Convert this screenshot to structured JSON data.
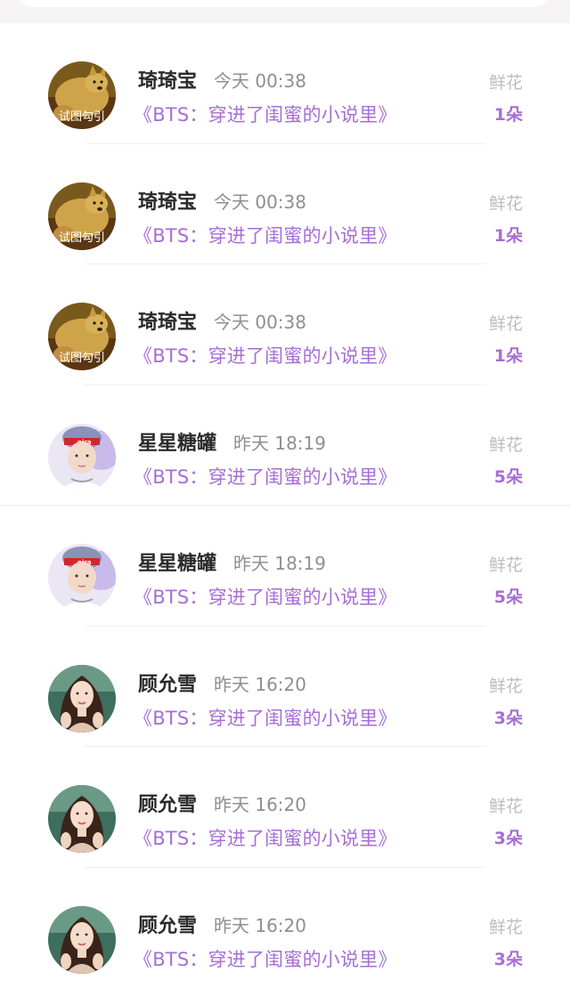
{
  "records": [
    {
      "name": "琦琦宝",
      "time": "今天 00:38",
      "book": "《BTS：穿进了闺蜜的小说里》",
      "gift_label": "鲜花",
      "gift_count": "1朵",
      "avatar": "dog-avatar",
      "avatar_caption": "试图勾引"
    },
    {
      "name": "琦琦宝",
      "time": "今天 00:38",
      "book": "《BTS：穿进了闺蜜的小说里》",
      "gift_label": "鲜花",
      "gift_count": "1朵",
      "avatar": "dog-avatar",
      "avatar_caption": "试图勾引"
    },
    {
      "name": "琦琦宝",
      "time": "今天 00:38",
      "book": "《BTS：穿进了闺蜜的小说里》",
      "gift_label": "鲜花",
      "gift_count": "1朵",
      "avatar": "dog-avatar",
      "avatar_caption": "试图勾引"
    },
    {
      "name": "星星糖罐",
      "time": "昨天 18:19",
      "book": "《BTS：穿进了闺蜜的小说里》",
      "gift_label": "鲜花",
      "gift_count": "5朵",
      "avatar": "man-avatar"
    },
    {
      "name": "星星糖罐",
      "time": "昨天 18:19",
      "book": "《BTS：穿进了闺蜜的小说里》",
      "gift_label": "鲜花",
      "gift_count": "5朵",
      "avatar": "man-avatar"
    },
    {
      "name": "顾允雪",
      "time": "昨天 16:20",
      "book": "《BTS：穿进了闺蜜的小说里》",
      "gift_label": "鲜花",
      "gift_count": "3朵",
      "avatar": "woman-avatar"
    },
    {
      "name": "顾允雪",
      "time": "昨天 16:20",
      "book": "《BTS：穿进了闺蜜的小说里》",
      "gift_label": "鲜花",
      "gift_count": "3朵",
      "avatar": "woman-avatar"
    },
    {
      "name": "顾允雪",
      "time": "昨天 16:20",
      "book": "《BTS：穿进了闺蜜的小说里》",
      "gift_label": "鲜花",
      "gift_count": "3朵",
      "avatar": "woman-avatar"
    }
  ],
  "colors": {
    "accent": "#a66ed6",
    "name": "#2a2a2a",
    "time": "#8f8f8f",
    "gift_label": "#bdbdbd",
    "header_bg": "#f7f4f6"
  }
}
